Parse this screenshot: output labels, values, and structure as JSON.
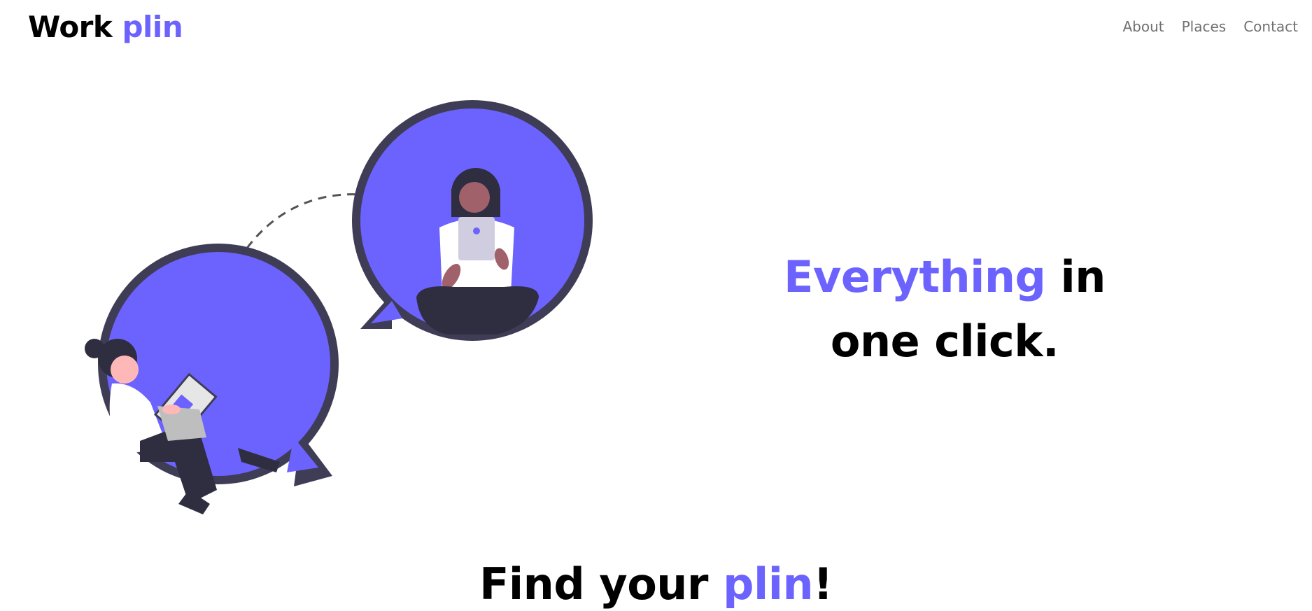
{
  "brand": {
    "part1": "Work",
    "part2": "plin"
  },
  "nav": {
    "about": "About",
    "places": "Places",
    "contact": "Contact"
  },
  "hero": {
    "accent_word": "Everything",
    "rest_line1": "in",
    "line2": "one click."
  },
  "section": {
    "prefix": "Find your ",
    "accent": "plin",
    "suffix": "!"
  },
  "colors": {
    "accent": "#6c63ff",
    "dark": "#3f3d56",
    "nav_text": "#707070"
  },
  "illustration": {
    "subject": "two people chatting in speech bubbles"
  }
}
